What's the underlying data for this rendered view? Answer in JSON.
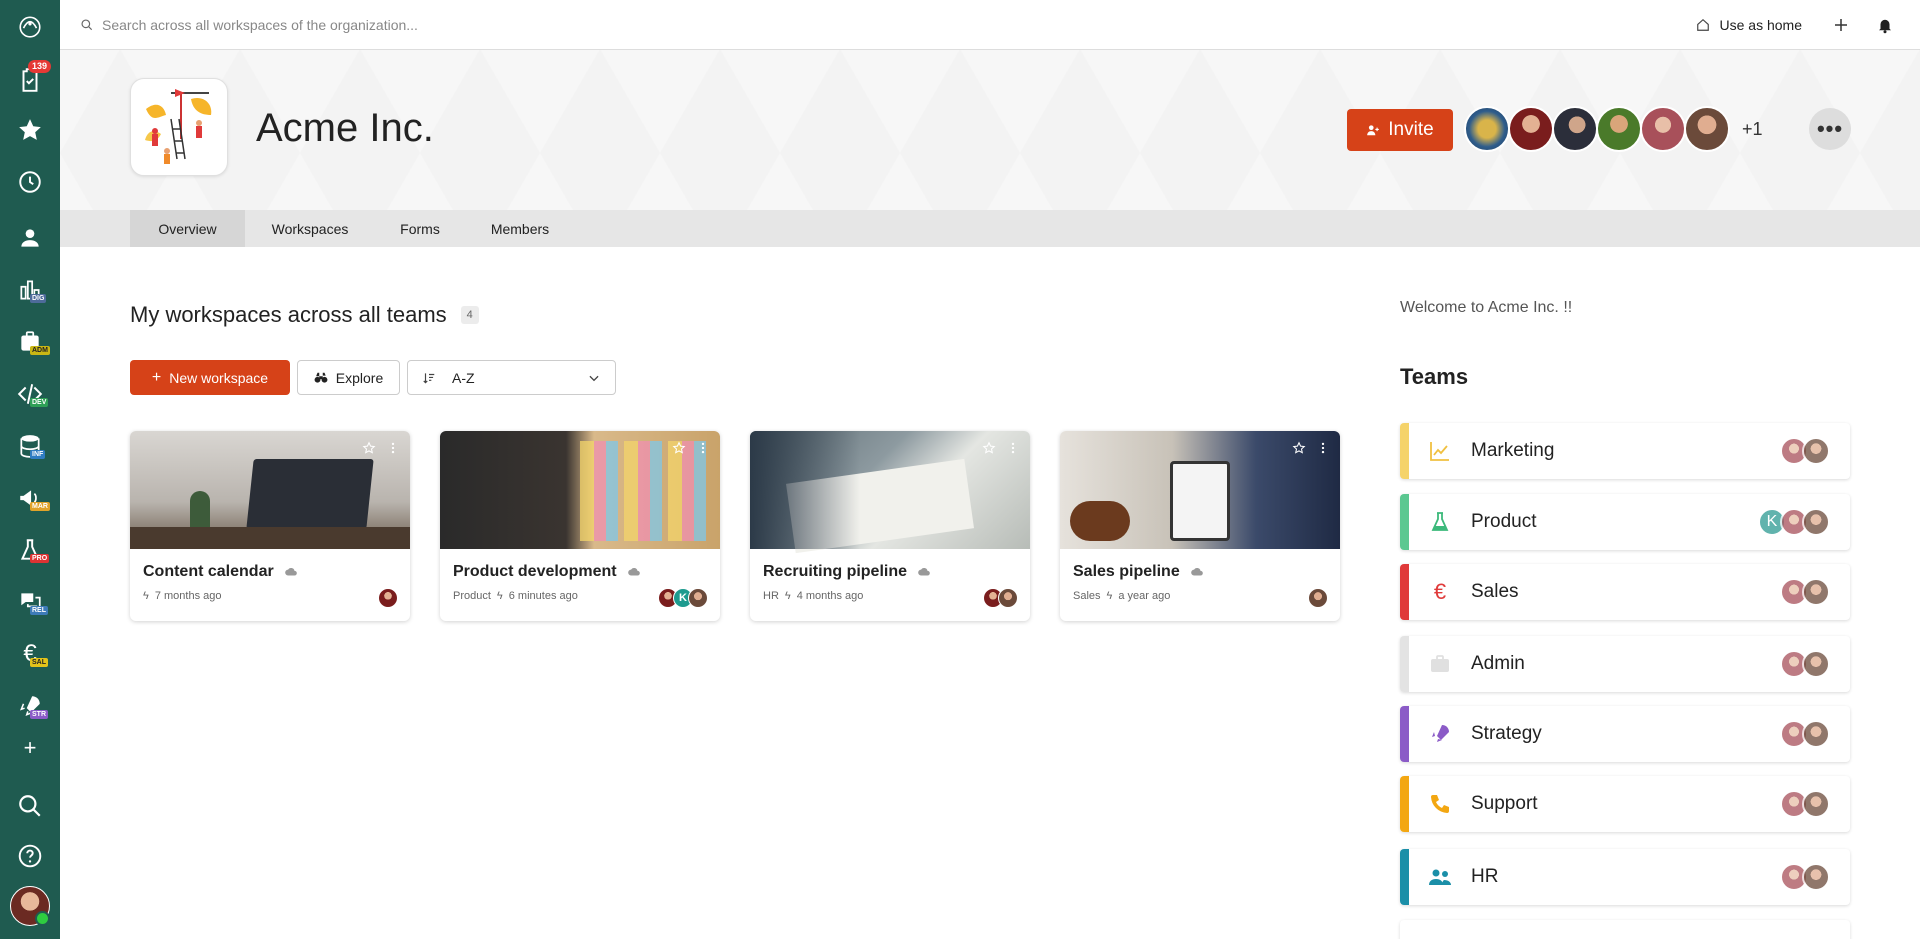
{
  "topbar": {
    "search_placeholder": "Search across all workspaces of the organization...",
    "use_as_home": "Use as home"
  },
  "rail": {
    "tasks_badge": "139",
    "workspace_tags": [
      "DIG",
      "ADM",
      "DEV",
      "INF",
      "MAR",
      "PRO",
      "REL",
      "SAL",
      "STR"
    ],
    "tag_colors": {
      "DIG": "#4e6b9a",
      "ADM": "#d4c423",
      "DEV": "#2e9f56",
      "INF": "#2f7cc2",
      "MAR": "#e0a32a",
      "PRO": "#d33",
      "REL": "#3d7bb8",
      "SAL": "#e3c31a",
      "STR": "#8b5bc7"
    }
  },
  "org": {
    "name": "Acme Inc.",
    "invite_label": "Invite",
    "extra_members": "+1"
  },
  "tabs": [
    "Overview",
    "Workspaces",
    "Forms",
    "Members"
  ],
  "workspaces": {
    "title": "My workspaces across all teams",
    "count": "4",
    "new_label": "New workspace",
    "explore_label": "Explore",
    "sort_value": "A-Z",
    "cards": [
      {
        "title": "Content calendar",
        "team": "",
        "time": "7 months ago"
      },
      {
        "title": "Product development",
        "team": "Product",
        "time": "6 minutes ago"
      },
      {
        "title": "Recruiting pipeline",
        "team": "HR",
        "time": "4 months ago"
      },
      {
        "title": "Sales pipeline",
        "team": "Sales",
        "time": "a year ago"
      }
    ],
    "avatar_letter": "K"
  },
  "sidebar": {
    "welcome": "Welcome to Acme Inc. !!",
    "teams_title": "Teams",
    "teams": [
      {
        "name": "Marketing",
        "color": "#f5d36a",
        "icon": "chart-line-icon"
      },
      {
        "name": "Product",
        "color": "#5bc891",
        "icon": "flask-icon"
      },
      {
        "name": "Sales",
        "color": "#e03a3a",
        "icon": "euro-icon"
      },
      {
        "name": "Admin",
        "color": "#e3e3e3",
        "icon": "briefcase-icon"
      },
      {
        "name": "Strategy",
        "color": "#8b5bc7",
        "icon": "rocket-icon"
      },
      {
        "name": "Support",
        "color": "#f3a712",
        "icon": "phone-icon"
      },
      {
        "name": "HR",
        "color": "#1b8fa8",
        "icon": "people-icon"
      }
    ],
    "product_team_letter": "K"
  },
  "colors": {
    "accent": "#d64218",
    "rail": "#1f5b50"
  }
}
